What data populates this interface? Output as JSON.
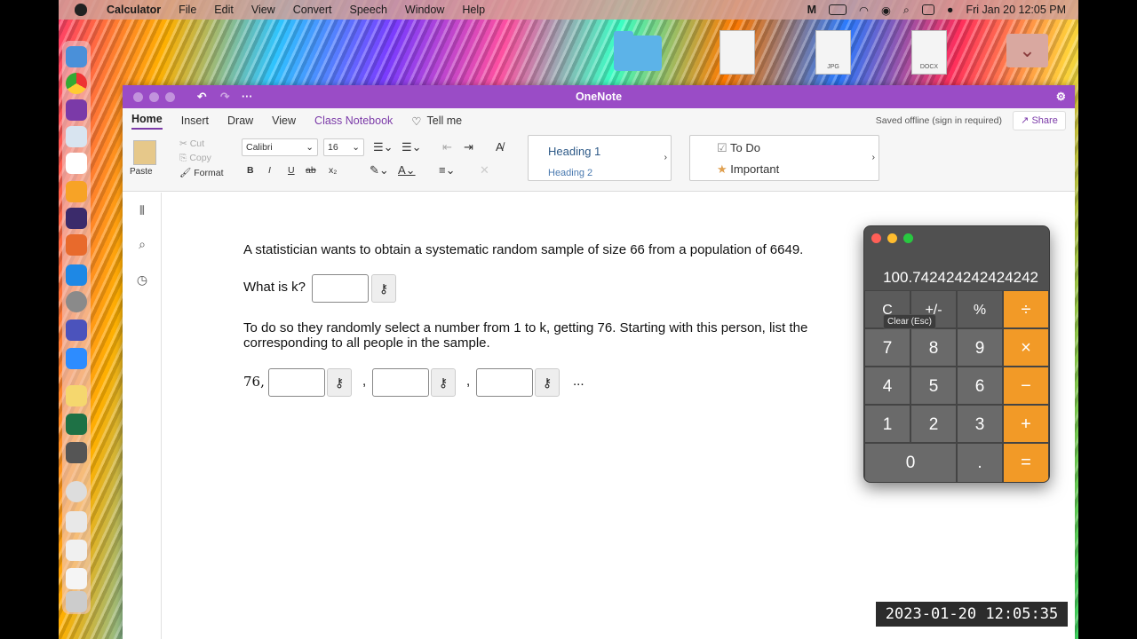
{
  "menubar": {
    "app_name": "Calculator",
    "items": [
      "File",
      "Edit",
      "View",
      "Convert",
      "Speech",
      "Window",
      "Help"
    ],
    "datetime": "Fri Jan 20  12:05 PM"
  },
  "desktop": {
    "files": [
      {
        "label": ""
      },
      {
        "label": "JPG"
      },
      {
        "label": "DOCX"
      }
    ]
  },
  "onenote": {
    "title": "OneNote",
    "tabs": [
      "Home",
      "Insert",
      "Draw",
      "View",
      "Class Notebook",
      "Tell me"
    ],
    "status": "Saved offline (sign in required)",
    "share_label": "Share",
    "ribbon": {
      "paste": "Paste",
      "cut": "Cut",
      "copy": "Copy",
      "format": "Format",
      "font": "Calibri",
      "size": "16",
      "bold": "B",
      "italic": "I",
      "underline": "U",
      "strike": "ab",
      "subscript": "x₂",
      "styles": [
        "Heading 1",
        "Heading 2"
      ],
      "tags": [
        "To Do",
        "Important"
      ]
    },
    "page": {
      "question1": "A statistician wants to obtain a systematic random sample of size 66 from a population of 6649.",
      "k_prompt": "What is k?",
      "question2_line1": "To do so they randomly select a number from 1 to k, getting 76. Starting with this person, list the",
      "question2_line2": "corresponding to all people in the sample.",
      "first_value": "76,",
      "separator": ",",
      "ellipsis": "..."
    }
  },
  "calculator": {
    "display": "100.742424242424242",
    "tooltip": "Clear (Esc)",
    "keys": {
      "clear": "C",
      "sign": "+/-",
      "percent": "%",
      "divide": "÷",
      "multiply": "×",
      "minus": "−",
      "plus": "+",
      "equals": "=",
      "zero": "0",
      "dot": ".",
      "digits": [
        "1",
        "2",
        "3",
        "4",
        "5",
        "6",
        "7",
        "8",
        "9"
      ]
    }
  },
  "timestamp": "2023-01-20 12:05:35"
}
